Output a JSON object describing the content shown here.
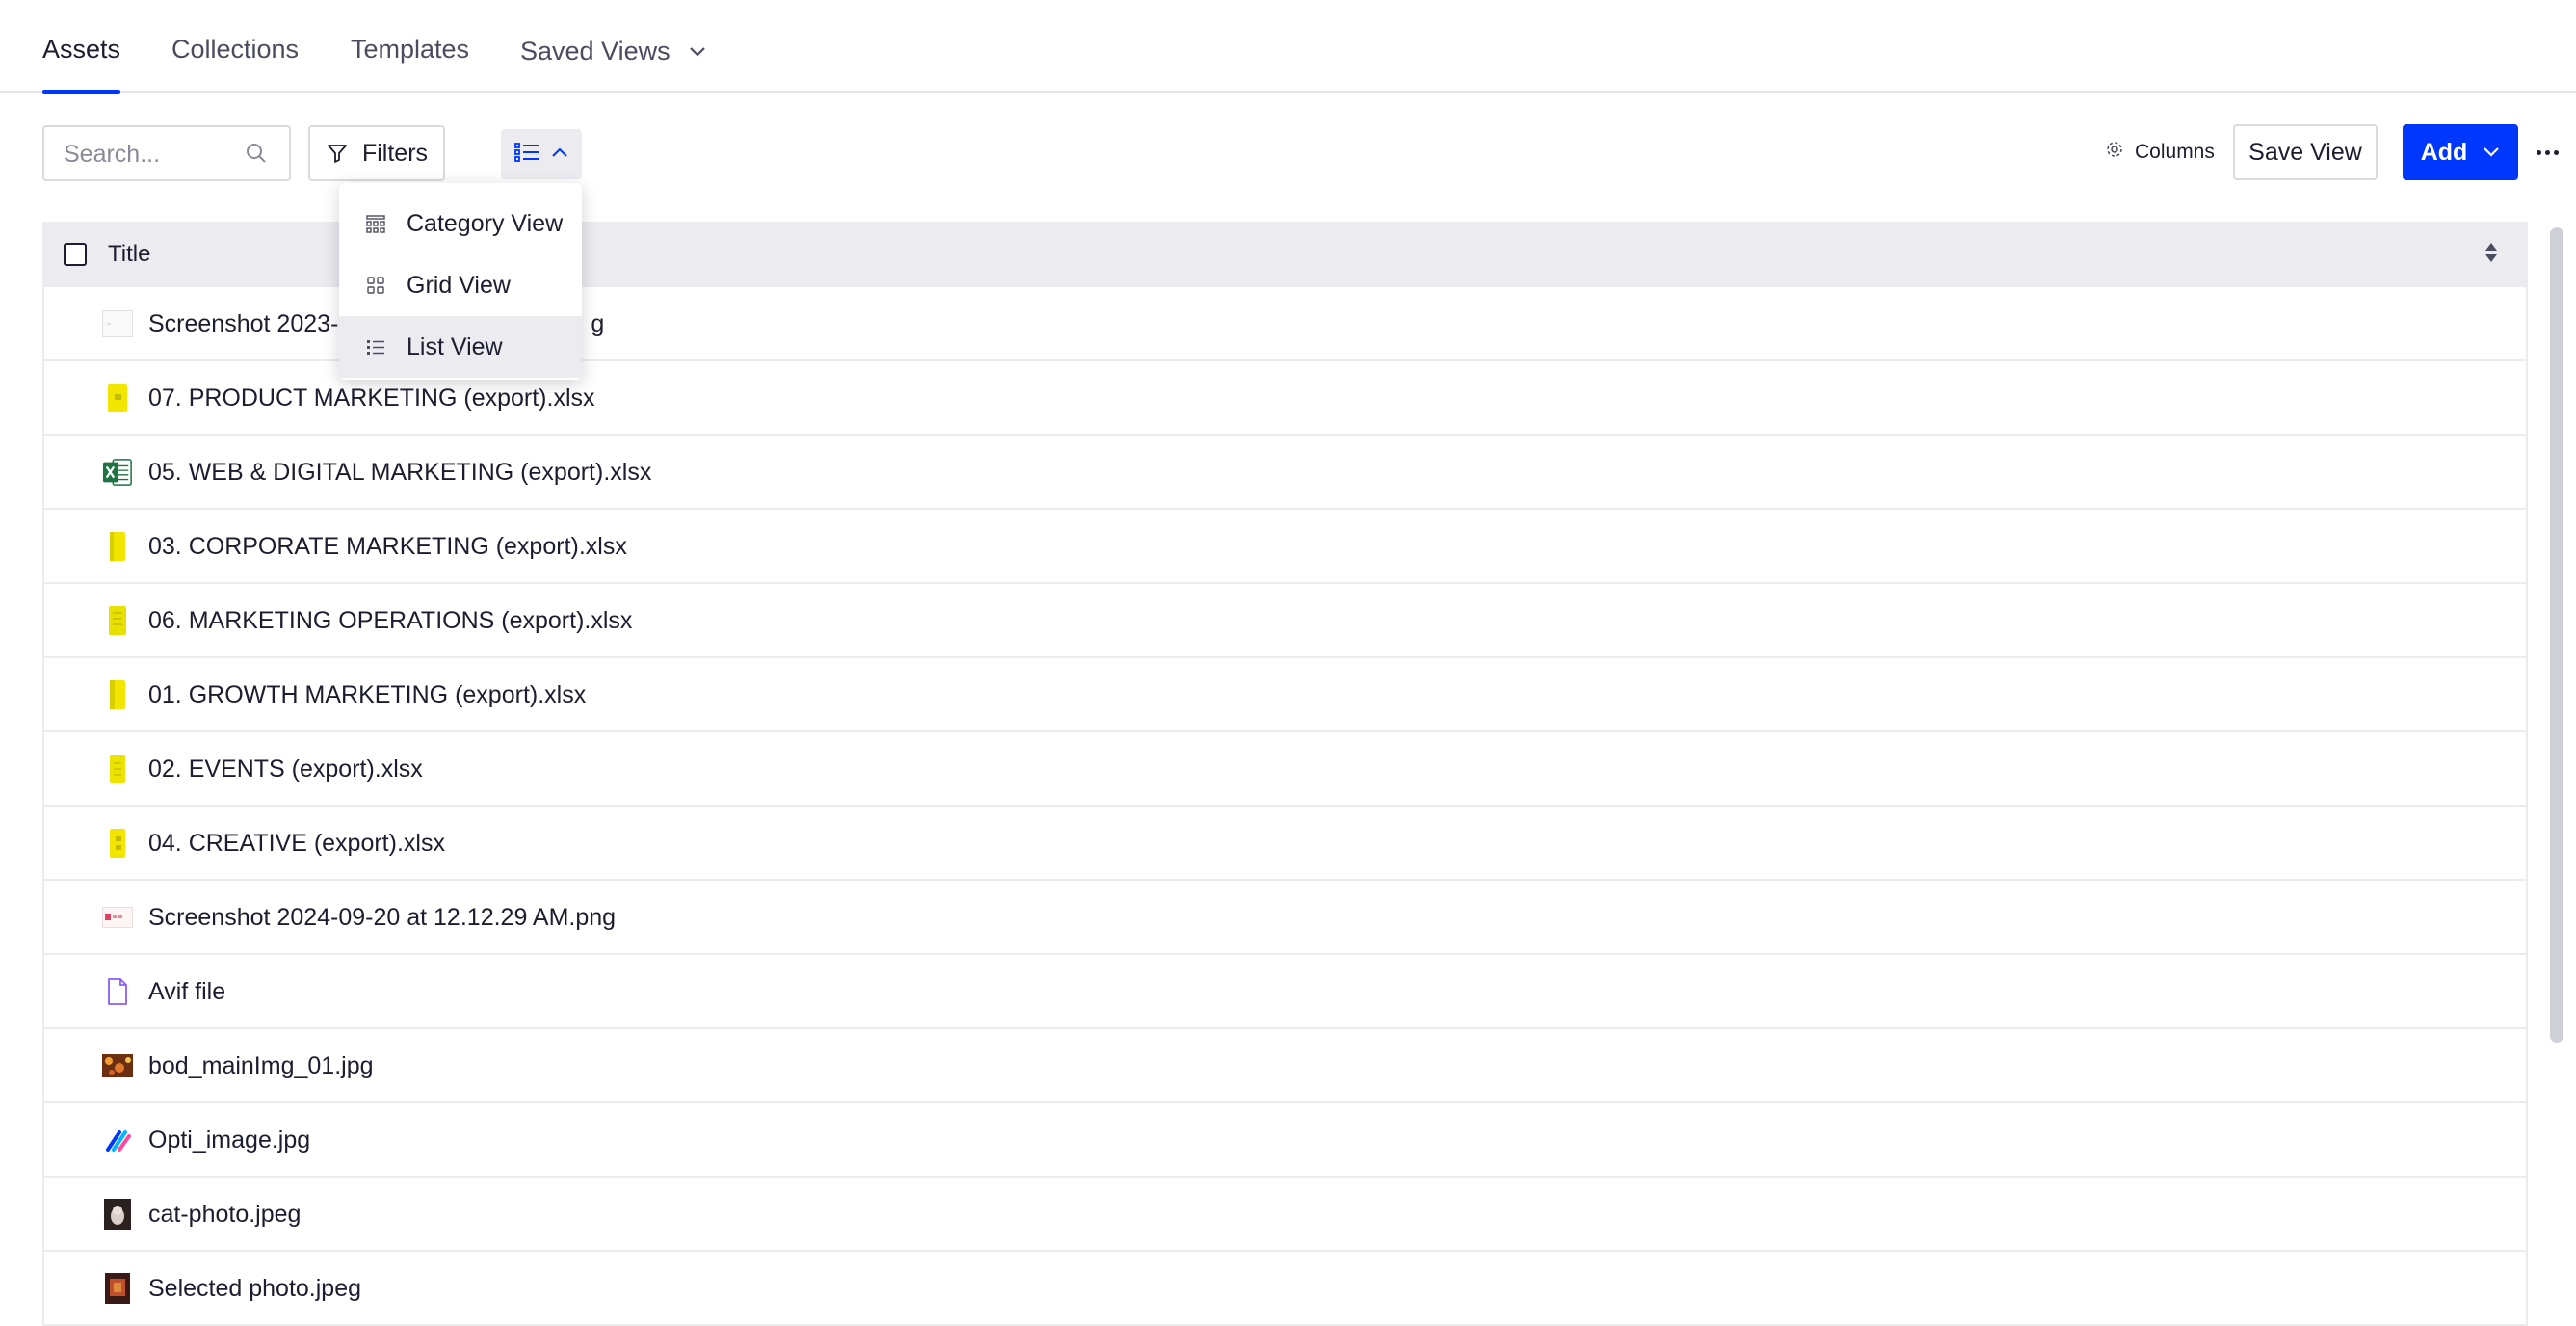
{
  "tabs": [
    {
      "label": "Assets",
      "active": true
    },
    {
      "label": "Collections",
      "active": false
    },
    {
      "label": "Templates",
      "active": false
    },
    {
      "label": "Saved Views",
      "active": false
    }
  ],
  "toolbar": {
    "search_placeholder": "Search...",
    "filters_label": "Filters",
    "columns_label": "Columns",
    "save_view_label": "Save View",
    "add_label": "Add"
  },
  "view_menu": {
    "items": [
      {
        "label": "Category View",
        "icon": "category-view-icon"
      },
      {
        "label": "Grid View",
        "icon": "grid-view-icon"
      },
      {
        "label": "List View",
        "icon": "list-view-icon",
        "selected": true
      }
    ]
  },
  "table": {
    "header_title": "Title",
    "rows": [
      {
        "name": "Screenshot 2023-[partially hidden]g",
        "visible_prefix": "Screenshot 2023-",
        "visible_suffix": "g",
        "icon": "screenshot-thumbnail"
      },
      {
        "name": "07. PRODUCT MARKETING (export).xlsx",
        "icon": "xlsx-yellow-icon"
      },
      {
        "name": "05. WEB & DIGITAL MARKETING (export).xlsx",
        "icon": "excel-icon"
      },
      {
        "name": "03. CORPORATE MARKETING (export).xlsx",
        "icon": "xlsx-yellow-icon"
      },
      {
        "name": "06. MARKETING OPERATIONS (export).xlsx",
        "icon": "xlsx-yellow-icon"
      },
      {
        "name": "01. GROWTH MARKETING (export).xlsx",
        "icon": "xlsx-yellow-icon"
      },
      {
        "name": "02. EVENTS (export).xlsx",
        "icon": "xlsx-yellow-icon"
      },
      {
        "name": "04. CREATIVE (export).xlsx",
        "icon": "xlsx-yellow-icon"
      },
      {
        "name": "Screenshot 2024-09-20 at 12.12.29 AM.png",
        "icon": "screenshot-thumbnail"
      },
      {
        "name": "Avif file",
        "icon": "file-icon"
      },
      {
        "name": "bod_mainImg_01.jpg",
        "icon": "image-thumbnail"
      },
      {
        "name": "Opti_image.jpg",
        "icon": "opti-logo-icon"
      },
      {
        "name": "cat-photo.jpeg",
        "icon": "cat-photo-thumbnail"
      },
      {
        "name": "Selected photo.jpeg",
        "icon": "photo-thumbnail"
      }
    ]
  },
  "colors": {
    "accent": "#0037ff",
    "header_bg": "#ebebf0",
    "border": "#d9d9e0",
    "text": "#1c1d2e",
    "xlsx_yellow": "#f2e600",
    "excel_green": "#1f7244",
    "file_purple": "#8b5cf6"
  }
}
